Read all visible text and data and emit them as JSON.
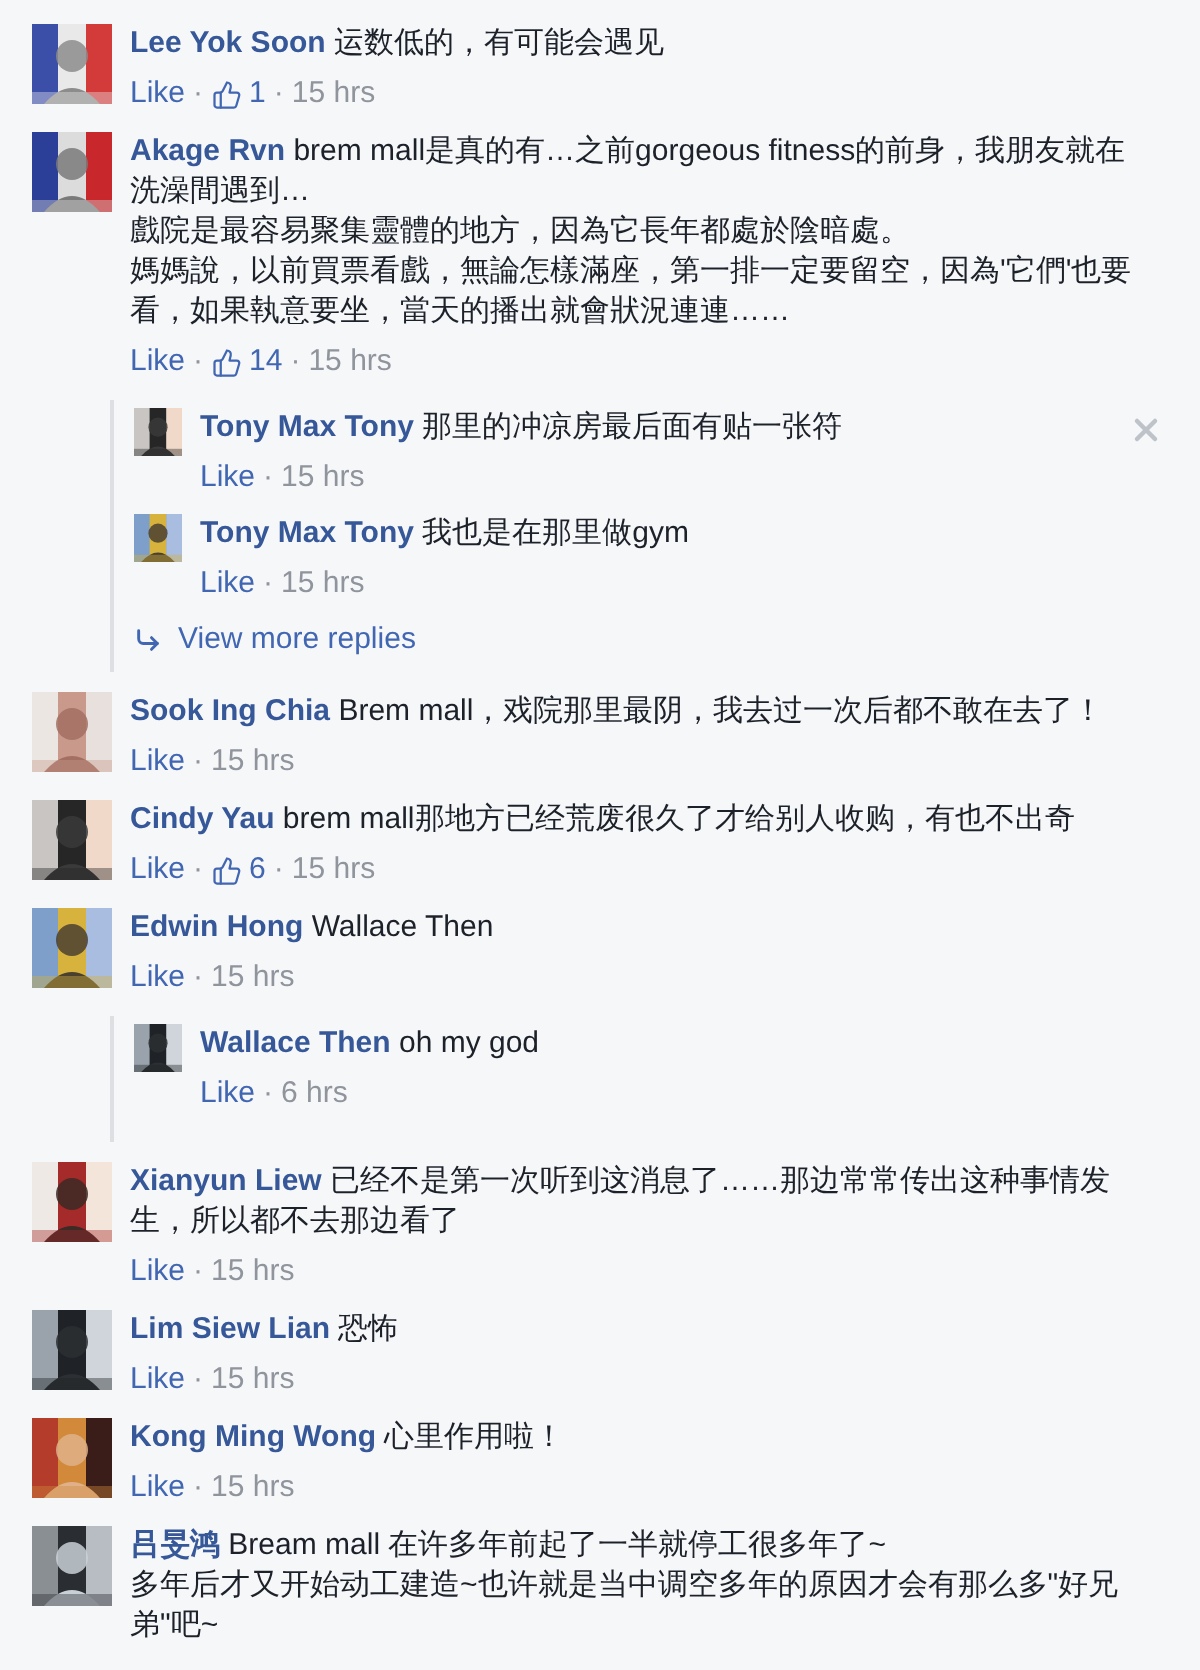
{
  "comments": [
    {
      "author": "Lee Yok Soon",
      "text": "运数低的，有可能会遇见",
      "like": "Like",
      "sep": "·",
      "likes": "1",
      "sep2": "·",
      "time": "15 hrs"
    },
    {
      "author": "Akage Rvn",
      "text": "brem mall是真的有…之前gorgeous fitness的前身，我朋友就在洗澡間遇到…",
      "more": [
        "戲院是最容易聚集靈體的地方，因為它長年都處於陰暗處。",
        "媽媽說，以前買票看戲，無論怎樣滿座，第一排一定要留空，因為'它們'也要看，如果執意要坐，當天的播出就會狀況連連……"
      ],
      "like": "Like",
      "sep": "·",
      "likes": "14",
      "sep2": "·",
      "time": "15 hrs",
      "replies": [
        {
          "author": "Tony Max Tony",
          "text": "那里的冲凉房最后面有贴一张符",
          "like": "Like",
          "sep": "·",
          "time": "15 hrs",
          "removable": true
        },
        {
          "author": "Tony Max Tony",
          "text": "我也是在那里做gym",
          "like": "Like",
          "sep": "·",
          "time": "15 hrs",
          "removable": false
        }
      ],
      "view_more": "View more replies"
    },
    {
      "author": "Sook Ing Chia",
      "text": "Brem mall，戏院那里最阴，我去过一次后都不敢在去了！",
      "like": "Like",
      "sep": "·",
      "time": "15 hrs"
    },
    {
      "author": "Cindy Yau",
      "text": "brem mall那地方已经荒废很久了才给别人收购，有也不出奇",
      "like": "Like",
      "sep": "·",
      "likes": "6",
      "sep2": "·",
      "time": "15 hrs"
    },
    {
      "author": "Edwin Hong",
      "text": "Wallace Then",
      "like": "Like",
      "sep": "·",
      "time": "15 hrs",
      "replies": [
        {
          "author": "Wallace Then",
          "text": "oh my god",
          "like": "Like",
          "sep": "·",
          "time": "6 hrs",
          "removable": false
        }
      ]
    },
    {
      "author": "Xianyun Liew",
      "text": "已经不是第一次听到这消息了……那边常常传出这种事情发生，所以都不去那边看了",
      "like": "Like",
      "sep": "·",
      "time": "15 hrs"
    },
    {
      "author": "Lim Siew Lian",
      "text": "恐怖",
      "like": "Like",
      "sep": "·",
      "time": "15 hrs"
    },
    {
      "author": "Kong Ming Wong",
      "text": "心里作用啦！",
      "like": "Like",
      "sep": "·",
      "time": "15 hrs"
    },
    {
      "author": "吕旻鸿",
      "text": "Bream mall 在许多年前起了一半就停工很多年了~",
      "more": [
        "多年后才又开始动工建造~也许就是当中调空多年的原因才会有那么多\"好兄弟\"吧~"
      ]
    }
  ]
}
